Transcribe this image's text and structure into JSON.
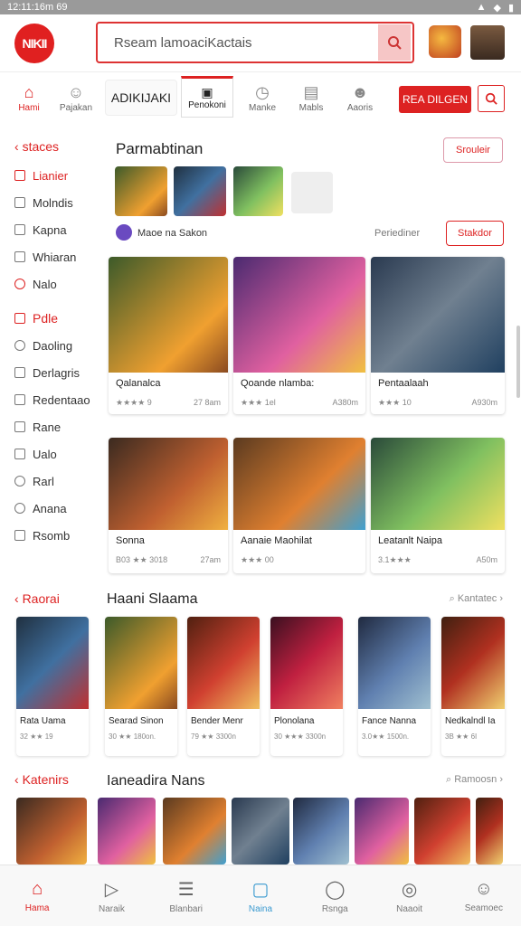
{
  "status": {
    "time": "12:11:16m 69"
  },
  "header": {
    "logo": "NIKII",
    "search_placeholder": "Rseam lamoaciKactais"
  },
  "nav": {
    "items": [
      {
        "label": "Hami",
        "icon": "home-icon"
      },
      {
        "label": "Pajakan",
        "icon": "person-icon"
      },
      {
        "label": "Manke",
        "icon": "clock-icon"
      },
      {
        "label": "Mabls",
        "icon": "image-icon"
      },
      {
        "label": "Aaoris",
        "icon": "face-icon"
      }
    ],
    "admin_label": "ADIKIJAKI",
    "selected_tab": "Penokoni",
    "cta_label": "REA DILGEN"
  },
  "sidebar": {
    "heading1": "staces",
    "group1": [
      "Lianier",
      "Molndis",
      "Kapna",
      "Whiaran",
      "Nalo"
    ],
    "heading2": "Pdle",
    "group2": [
      "Daoling",
      "Derlagris",
      "Redentaao",
      "Rane",
      "Ualo",
      "Rarl",
      "Anana",
      "Rsomb"
    ]
  },
  "featured": {
    "title": "Parmabtinan",
    "button": "Srouleir",
    "creator": "Maoe na Sakon",
    "filter_label": "Periediner",
    "filter_button": "Stakdor"
  },
  "cards_row1": [
    {
      "title": "Qalanalca",
      "meta": "★★★★ 9",
      "right": "27 8am"
    },
    {
      "title": "Qoande nlamba:",
      "meta": "★★★ 1el",
      "right": "A380m"
    },
    {
      "title": "Pentaalaah",
      "meta": "★★★ 10",
      "right": "A930m"
    }
  ],
  "cards_row2": [
    {
      "title": "Sonna",
      "meta": "B03 ★★ 3018",
      "right": "27am"
    },
    {
      "title": "Aanaie Maohilat",
      "meta": "★★★ 00",
      "right": ""
    },
    {
      "title": "Leatanlt Naipa",
      "meta": "3.1★★★",
      "right": "A50m"
    }
  ],
  "row3": {
    "heading": "Raorai",
    "title": "Haani Slaama",
    "link": "Kantatec",
    "items": [
      {
        "title": "Rata Uama",
        "meta": "32 ★★ 19"
      },
      {
        "title": "Searad Sinon",
        "meta": "30 ★★ 180on."
      },
      {
        "title": "Bender Menr",
        "meta": "79 ★★ 3300n"
      },
      {
        "title": "Plonolana",
        "meta": "30 ★★★ 3300n"
      },
      {
        "title": "Fance Nanna",
        "meta": "3.0★★ 1500n."
      },
      {
        "title": "Nedkalndl Ia",
        "meta": "3B ★★ 6I"
      }
    ]
  },
  "row4": {
    "heading": "Katenirs",
    "title": "Ianeadira Nans",
    "link": "Ramoosn"
  },
  "bottom_nav": [
    {
      "label": "Hama",
      "icon": "home-icon"
    },
    {
      "label": "Naraik",
      "icon": "play-icon"
    },
    {
      "label": "Blanbari",
      "icon": "list-icon"
    },
    {
      "label": "Naina",
      "icon": "box-icon"
    },
    {
      "label": "Rsnga",
      "icon": "chat-icon"
    },
    {
      "label": "Naaoit",
      "icon": "bell-icon"
    },
    {
      "label": "Seamoec",
      "icon": "user-icon"
    }
  ],
  "colors": {
    "accent": "#dd2222",
    "background": "#ffffff"
  }
}
